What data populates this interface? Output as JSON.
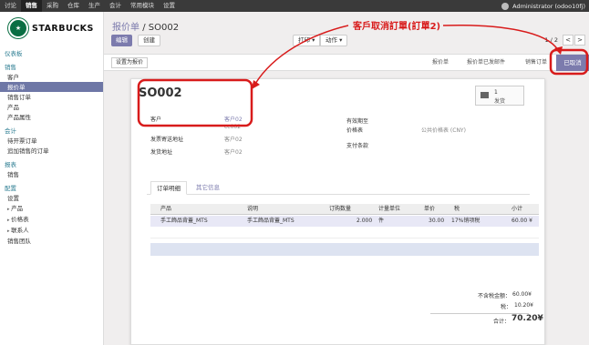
{
  "topbar": {
    "menu": [
      "讨论",
      "销售",
      "采购",
      "仓库",
      "生产",
      "会计",
      "常用模块",
      "设置"
    ],
    "active_index": 1,
    "user": "Administrator (odoo10fj)"
  },
  "sidebar": {
    "logo_text": "STARBUCKS",
    "sections": [
      {
        "title": "仪表板",
        "items": []
      },
      {
        "title": "销售",
        "items": [
          {
            "label": "客户",
            "active": false,
            "caret": false
          },
          {
            "label": "报价单",
            "active": true,
            "caret": false
          },
          {
            "label": "销售订单",
            "active": false,
            "caret": false
          },
          {
            "label": "产品",
            "active": false,
            "caret": false
          },
          {
            "label": "产品属性",
            "active": false,
            "caret": false
          }
        ]
      },
      {
        "title": "会计",
        "items": [
          {
            "label": "待开票订单",
            "active": false,
            "caret": false
          },
          {
            "label": "追加销售的订单",
            "active": false,
            "caret": false
          }
        ]
      },
      {
        "title": "报表",
        "items": [
          {
            "label": "销售",
            "active": false,
            "caret": false
          }
        ]
      },
      {
        "title": "配置",
        "items": [
          {
            "label": "设置",
            "active": false,
            "caret": false
          },
          {
            "label": "产品",
            "active": false,
            "caret": true
          },
          {
            "label": "价格表",
            "active": false,
            "caret": true
          },
          {
            "label": "联系人",
            "active": false,
            "caret": true
          },
          {
            "label": "销售团队",
            "active": false,
            "caret": false
          }
        ]
      }
    ]
  },
  "breadcrumb": {
    "parent": "报价单",
    "separator": "/",
    "current": "SO002"
  },
  "actions": {
    "edit": "编辑",
    "create": "创建",
    "print": "打印",
    "action": "动作"
  },
  "pager": {
    "text": "1 / 2",
    "prev": "<",
    "next": ">"
  },
  "statusbar": {
    "set_quote": "设置为报价",
    "stages": [
      "报价单",
      "报价单已发邮件",
      "销售订单"
    ],
    "active_stage": "已取消"
  },
  "sheet": {
    "title": "SO002",
    "delivery_count": "1",
    "delivery_label": "发货",
    "fields_left": [
      {
        "label": "客户",
        "value": "客户02",
        "link": true
      },
      {
        "label": "",
        "value": "cc002",
        "link": false
      },
      {
        "label": "发票寄送地址",
        "value": "客户02",
        "link": false
      },
      {
        "label": "发货地址",
        "value": "客户02",
        "link": false
      }
    ],
    "fields_right": [
      {
        "label": "有效期至",
        "value": ""
      },
      {
        "label": "价格表",
        "value": "公共价格表 (CNY)"
      },
      {
        "label": "支付条款",
        "value": ""
      }
    ],
    "tabs": [
      "订单明细",
      "其它信息"
    ],
    "columns": [
      "产品",
      "说明",
      "订购数量",
      "计量单位",
      "单价",
      "税",
      "小计"
    ],
    "rows": [
      {
        "product": "手工飾品背蓋_MTS",
        "desc": "手工飾品背蓋_MTS",
        "qty": "2.000",
        "uom": "件",
        "price": "30.00",
        "tax": "17%销项税",
        "subtotal": "60.00 ¥"
      }
    ],
    "totals": {
      "untaxed_label": "不含税金额：",
      "untaxed": "60.00¥",
      "tax_label": "税：",
      "tax": "10.20¥",
      "total_label": "合计：",
      "total": "70.20¥"
    }
  },
  "annotation": {
    "text": "客戶取消訂單(訂單2)",
    "color": "#d81b1b"
  }
}
